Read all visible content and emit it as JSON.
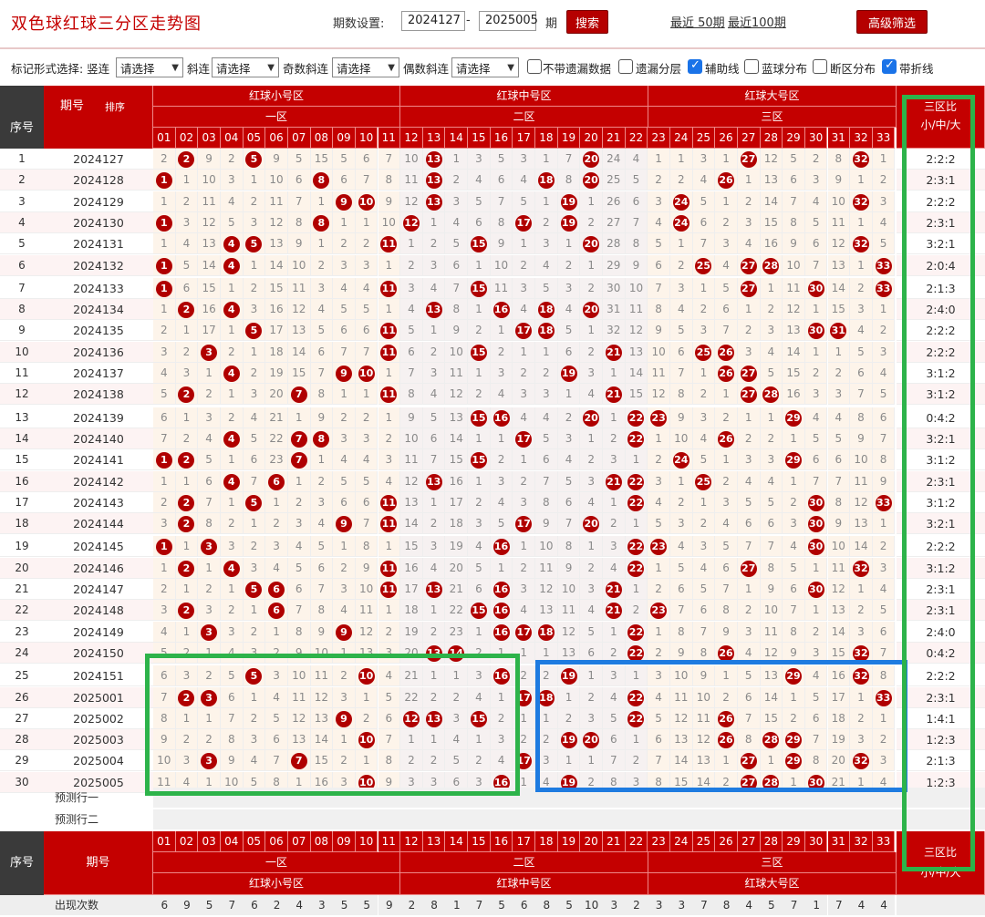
{
  "title": "双色球红球三分区走势图",
  "period": {
    "label": "期数设置:",
    "from": "2024127",
    "dash": "-",
    "to": "2025005",
    "unit": "期",
    "search": "搜索",
    "recent50": "最近 50期",
    "recent100": "最近100期",
    "advanced": "高级筛选"
  },
  "options": {
    "lead": "标记形式选择: 竖连",
    "sel_vertical": "请选择",
    "slant": "斜连",
    "sel_slant": "请选择",
    "odd": "奇数斜连",
    "sel_odd": "请选择",
    "even": "偶数斜连",
    "sel_even": "请选择",
    "checks": [
      {
        "label": "不带遗漏数据",
        "checked": false
      },
      {
        "label": "遗漏分层",
        "checked": false
      },
      {
        "label": "辅助线",
        "checked": true
      },
      {
        "label": "蓝球分布",
        "checked": false
      },
      {
        "label": "断区分布",
        "checked": false
      },
      {
        "label": "带折线",
        "checked": true
      }
    ]
  },
  "header": {
    "seq": "序号",
    "period": "期号",
    "sort": "排序",
    "small": "红球小号区",
    "mid": "红球中号区",
    "big": "红球大号区",
    "z1": "一区",
    "z2": "二区",
    "z3": "三区",
    "ratio": "三区比",
    "ratio_sub": "小/中/大",
    "nums": [
      "01",
      "02",
      "03",
      "04",
      "05",
      "06",
      "07",
      "08",
      "09",
      "10",
      "11",
      "12",
      "13",
      "14",
      "15",
      "16",
      "17",
      "18",
      "19",
      "20",
      "21",
      "22",
      "23",
      "24",
      "25",
      "26",
      "27",
      "28",
      "29",
      "30",
      "31",
      "32",
      "33"
    ]
  },
  "rows": [
    {
      "seq": "1",
      "period": "2024127",
      "ratio": "2:2:2",
      "cells": [
        2,
        -2,
        9,
        2,
        -5,
        9,
        5,
        15,
        5,
        6,
        7,
        10,
        -13,
        1,
        3,
        5,
        3,
        1,
        7,
        -20,
        24,
        4,
        1,
        1,
        3,
        1,
        -27,
        12,
        5,
        2,
        8,
        -32,
        1
      ]
    },
    {
      "seq": "2",
      "period": "2024128",
      "ratio": "2:3:1",
      "cells": [
        -1,
        1,
        10,
        3,
        1,
        10,
        6,
        -8,
        6,
        7,
        8,
        11,
        -13,
        2,
        4,
        6,
        4,
        -18,
        8,
        -20,
        25,
        5,
        2,
        2,
        4,
        -26,
        1,
        13,
        6,
        3,
        9,
        1,
        2
      ]
    },
    {
      "seq": "3",
      "period": "2024129",
      "ratio": "2:2:2",
      "cells": [
        1,
        2,
        11,
        4,
        2,
        11,
        7,
        1,
        -9,
        -10,
        9,
        12,
        -13,
        3,
        5,
        7,
        5,
        1,
        -19,
        1,
        26,
        6,
        3,
        -24,
        5,
        1,
        2,
        14,
        7,
        4,
        10,
        -32,
        3
      ]
    },
    {
      "seq": "4",
      "period": "2024130",
      "ratio": "2:3:1",
      "cells": [
        -1,
        3,
        12,
        5,
        3,
        12,
        8,
        -8,
        1,
        1,
        10,
        -12,
        1,
        4,
        6,
        8,
        -17,
        2,
        -19,
        2,
        27,
        7,
        4,
        -24,
        6,
        2,
        3,
        15,
        8,
        5,
        11,
        1,
        4
      ]
    },
    {
      "seq": "5",
      "period": "2024131",
      "ratio": "3:2:1",
      "cells": [
        1,
        4,
        13,
        -4,
        -5,
        13,
        9,
        1,
        2,
        2,
        -11,
        1,
        2,
        5,
        -15,
        9,
        1,
        3,
        1,
        -20,
        28,
        8,
        5,
        1,
        7,
        3,
        4,
        16,
        9,
        6,
        12,
        -32,
        5
      ]
    },
    {
      "seq": "6",
      "period": "2024132",
      "ratio": "2:0:4",
      "cells": [
        -1,
        5,
        14,
        -4,
        1,
        14,
        10,
        2,
        3,
        3,
        1,
        2,
        3,
        6,
        1,
        10,
        2,
        4,
        2,
        1,
        29,
        9,
        6,
        2,
        -25,
        4,
        -27,
        -28,
        10,
        7,
        13,
        1,
        -33
      ]
    },
    {
      "seq": "7",
      "period": "2024133",
      "ratio": "2:1:3",
      "cells": [
        -1,
        6,
        15,
        1,
        2,
        15,
        11,
        3,
        4,
        4,
        -11,
        3,
        4,
        7,
        -15,
        11,
        3,
        5,
        3,
        2,
        30,
        10,
        7,
        3,
        1,
        5,
        -27,
        1,
        11,
        -30,
        14,
        2,
        -33
      ]
    },
    {
      "seq": "8",
      "period": "2024134",
      "ratio": "2:4:0",
      "cells": [
        1,
        -2,
        16,
        -4,
        3,
        16,
        12,
        4,
        5,
        5,
        1,
        4,
        -13,
        8,
        1,
        -16,
        4,
        -18,
        4,
        -20,
        31,
        11,
        8,
        4,
        2,
        6,
        1,
        2,
        12,
        1,
        15,
        3,
        1
      ]
    },
    {
      "seq": "9",
      "period": "2024135",
      "ratio": "2:2:2",
      "cells": [
        2,
        1,
        17,
        1,
        -5,
        17,
        13,
        5,
        6,
        6,
        -11,
        5,
        1,
        9,
        2,
        1,
        -17,
        -18,
        5,
        1,
        32,
        12,
        9,
        5,
        3,
        7,
        2,
        3,
        13,
        -30,
        -31,
        4,
        2
      ]
    },
    {
      "seq": "10",
      "period": "2024136",
      "ratio": "2:2:2",
      "cells": [
        3,
        2,
        -3,
        2,
        1,
        18,
        14,
        6,
        7,
        7,
        -11,
        6,
        2,
        10,
        -15,
        2,
        1,
        1,
        6,
        2,
        -21,
        13,
        10,
        6,
        -25,
        -26,
        3,
        4,
        14,
        1,
        1,
        5,
        3
      ]
    },
    {
      "seq": "11",
      "period": "2024137",
      "ratio": "3:1:2",
      "cells": [
        4,
        3,
        1,
        -4,
        2,
        19,
        15,
        7,
        -9,
        -10,
        1,
        7,
        3,
        11,
        1,
        3,
        2,
        2,
        -19,
        3,
        1,
        14,
        11,
        7,
        1,
        -26,
        -27,
        5,
        15,
        2,
        2,
        6,
        4
      ]
    },
    {
      "seq": "12",
      "period": "2024138",
      "ratio": "3:1:2",
      "cells": [
        5,
        -2,
        2,
        1,
        3,
        20,
        -7,
        8,
        1,
        1,
        -11,
        8,
        4,
        12,
        2,
        4,
        3,
        3,
        1,
        4,
        -21,
        15,
        12,
        8,
        2,
        1,
        -27,
        -28,
        16,
        3,
        3,
        7,
        5
      ]
    },
    {
      "seq": "13",
      "period": "2024139",
      "ratio": "0:4:2",
      "cells": [
        6,
        1,
        3,
        2,
        4,
        21,
        1,
        9,
        2,
        2,
        1,
        9,
        5,
        13,
        -15,
        -16,
        4,
        4,
        2,
        -20,
        1,
        -22,
        -23,
        9,
        3,
        2,
        1,
        1,
        -29,
        4,
        4,
        8,
        6
      ]
    },
    {
      "seq": "14",
      "period": "2024140",
      "ratio": "3:2:1",
      "cells": [
        7,
        2,
        4,
        -4,
        5,
        22,
        -7,
        -8,
        3,
        3,
        2,
        10,
        6,
        14,
        1,
        1,
        -17,
        5,
        3,
        1,
        2,
        -22,
        1,
        10,
        4,
        -26,
        2,
        2,
        1,
        5,
        5,
        9,
        7
      ]
    },
    {
      "seq": "15",
      "period": "2024141",
      "ratio": "3:1:2",
      "cells": [
        -1,
        -2,
        5,
        1,
        6,
        23,
        -7,
        1,
        4,
        4,
        3,
        11,
        7,
        15,
        -15,
        2,
        1,
        6,
        4,
        2,
        3,
        1,
        2,
        -24,
        5,
        1,
        3,
        3,
        -29,
        6,
        6,
        10,
        8
      ]
    },
    {
      "seq": "16",
      "period": "2024142",
      "ratio": "2:3:1",
      "cells": [
        1,
        1,
        6,
        -4,
        7,
        -6,
        1,
        2,
        5,
        5,
        4,
        12,
        -13,
        16,
        1,
        3,
        2,
        7,
        5,
        3,
        -21,
        -22,
        3,
        1,
        -25,
        2,
        4,
        4,
        1,
        7,
        7,
        11,
        9
      ]
    },
    {
      "seq": "17",
      "period": "2024143",
      "ratio": "3:1:2",
      "cells": [
        2,
        -2,
        7,
        1,
        -5,
        1,
        2,
        3,
        6,
        6,
        -11,
        13,
        1,
        17,
        2,
        4,
        3,
        8,
        6,
        4,
        1,
        -22,
        4,
        2,
        1,
        3,
        5,
        5,
        2,
        -30,
        8,
        12,
        -33
      ]
    },
    {
      "seq": "18",
      "period": "2024144",
      "ratio": "3:2:1",
      "cells": [
        3,
        -2,
        8,
        2,
        1,
        2,
        3,
        4,
        -9,
        7,
        -11,
        14,
        2,
        18,
        3,
        5,
        -17,
        9,
        7,
        -20,
        2,
        1,
        5,
        3,
        2,
        4,
        6,
        6,
        3,
        -30,
        9,
        13,
        1
      ]
    },
    {
      "seq": "19",
      "period": "2024145",
      "ratio": "2:2:2",
      "cells": [
        -1,
        1,
        -3,
        3,
        2,
        3,
        4,
        5,
        1,
        8,
        1,
        15,
        3,
        19,
        4,
        -16,
        1,
        10,
        8,
        1,
        3,
        -22,
        -23,
        4,
        3,
        5,
        7,
        7,
        4,
        -30,
        10,
        14,
        2
      ]
    },
    {
      "seq": "20",
      "period": "2024146",
      "ratio": "3:1:2",
      "cells": [
        1,
        -2,
        1,
        -4,
        3,
        4,
        5,
        6,
        2,
        9,
        -11,
        16,
        4,
        20,
        5,
        1,
        2,
        11,
        9,
        2,
        4,
        -22,
        1,
        5,
        4,
        6,
        -27,
        8,
        5,
        1,
        11,
        -32,
        3
      ]
    },
    {
      "seq": "21",
      "period": "2024147",
      "ratio": "2:3:1",
      "cells": [
        2,
        1,
        2,
        1,
        -5,
        -5,
        6,
        7,
        3,
        10,
        -11,
        17,
        -13,
        21,
        6,
        -16,
        3,
        12,
        10,
        3,
        -21,
        1,
        2,
        6,
        5,
        7,
        1,
        9,
        6,
        -30,
        12,
        1,
        4
      ]
    },
    {
      "seq": "22",
      "period": "2024148",
      "ratio": "2:3:1",
      "cells": [
        3,
        -2,
        3,
        2,
        1,
        -6,
        7,
        8,
        4,
        11,
        1,
        18,
        1,
        22,
        -15,
        -16,
        4,
        13,
        11,
        4,
        -21,
        2,
        -23,
        7,
        6,
        8,
        2,
        10,
        7,
        1,
        13,
        2,
        5
      ]
    },
    {
      "seq": "23",
      "period": "2024149",
      "ratio": "2:4:0",
      "cells": [
        4,
        1,
        -3,
        3,
        2,
        1,
        8,
        9,
        -9,
        12,
        2,
        19,
        2,
        23,
        1,
        -16,
        -17,
        -18,
        12,
        5,
        1,
        -22,
        1,
        8,
        7,
        9,
        3,
        11,
        8,
        2,
        14,
        3,
        6
      ]
    },
    {
      "seq": "24",
      "period": "2024150",
      "ratio": "0:4:2",
      "cells": [
        5,
        2,
        1,
        4,
        3,
        2,
        9,
        10,
        1,
        13,
        3,
        20,
        -13,
        -14,
        2,
        1,
        1,
        1,
        13,
        6,
        2,
        -22,
        2,
        9,
        8,
        -26,
        4,
        12,
        9,
        3,
        15,
        -32,
        7
      ]
    },
    {
      "seq": "25",
      "period": "2024151",
      "ratio": "2:2:2",
      "cells": [
        6,
        3,
        2,
        5,
        -5,
        3,
        10,
        11,
        2,
        -10,
        4,
        21,
        1,
        1,
        3,
        -16,
        2,
        2,
        -19,
        1,
        3,
        1,
        3,
        10,
        9,
        1,
        5,
        13,
        -29,
        4,
        16,
        -32,
        8
      ]
    },
    {
      "seq": "26",
      "period": "2025001",
      "ratio": "2:3:1",
      "cells": [
        7,
        -2,
        -3,
        6,
        1,
        4,
        11,
        12,
        3,
        1,
        5,
        22,
        2,
        2,
        4,
        1,
        -17,
        -18,
        1,
        2,
        4,
        -22,
        4,
        11,
        10,
        2,
        6,
        14,
        1,
        5,
        17,
        1,
        -33
      ]
    },
    {
      "seq": "27",
      "period": "2025002",
      "ratio": "1:4:1",
      "cells": [
        8,
        1,
        1,
        7,
        2,
        5,
        12,
        13,
        -9,
        2,
        6,
        -12,
        -13,
        3,
        -15,
        2,
        1,
        1,
        2,
        3,
        5,
        -22,
        5,
        12,
        11,
        -26,
        7,
        15,
        2,
        6,
        18,
        2,
        1
      ]
    },
    {
      "seq": "28",
      "period": "2025003",
      "ratio": "1:2:3",
      "cells": [
        9,
        2,
        2,
        8,
        3,
        6,
        13,
        14,
        1,
        -10,
        7,
        1,
        1,
        4,
        1,
        3,
        2,
        2,
        -19,
        -20,
        6,
        1,
        6,
        13,
        12,
        -26,
        8,
        -28,
        -29,
        7,
        19,
        3,
        2
      ]
    },
    {
      "seq": "29",
      "period": "2025004",
      "ratio": "2:1:3",
      "cells": [
        10,
        3,
        -3,
        9,
        4,
        7,
        -7,
        15,
        2,
        1,
        8,
        2,
        2,
        5,
        2,
        4,
        -17,
        3,
        1,
        1,
        7,
        2,
        7,
        14,
        13,
        1,
        -27,
        1,
        -29,
        8,
        20,
        -32,
        3
      ]
    },
    {
      "seq": "30",
      "period": "2025005",
      "ratio": "1:2:3",
      "cells": [
        11,
        4,
        1,
        10,
        5,
        8,
        1,
        16,
        3,
        -10,
        9,
        3,
        3,
        6,
        3,
        -16,
        1,
        4,
        -19,
        2,
        8,
        3,
        8,
        15,
        14,
        2,
        -27,
        -28,
        1,
        -30,
        21,
        1,
        4
      ]
    }
  ],
  "predict1": "预测行一",
  "predict2": "预测行二",
  "footer": {
    "seq": "序号",
    "period": "期号",
    "z1": "一区",
    "z2": "二区",
    "z3": "三区",
    "small": "红球小号区",
    "mid": "红球中号区",
    "big": "红球大号区",
    "ratio": "三区比",
    "ratio_sub": "小/中/大",
    "count_label": "出现次数",
    "counts": [
      "6",
      "9",
      "5",
      "7",
      "6",
      "2",
      "4",
      "3",
      "5",
      "5",
      "9",
      "2",
      "8",
      "1",
      "7",
      "5",
      "6",
      "8",
      "5",
      "10",
      "3",
      "2",
      "3",
      "3",
      "7",
      "8",
      "4",
      "5",
      "7",
      "1",
      "7",
      "4",
      "4"
    ]
  },
  "colors": {
    "accent": "#c40000",
    "ball": "#b00000",
    "highlight_green": "#2db34a",
    "highlight_blue": "#1e7be0"
  }
}
